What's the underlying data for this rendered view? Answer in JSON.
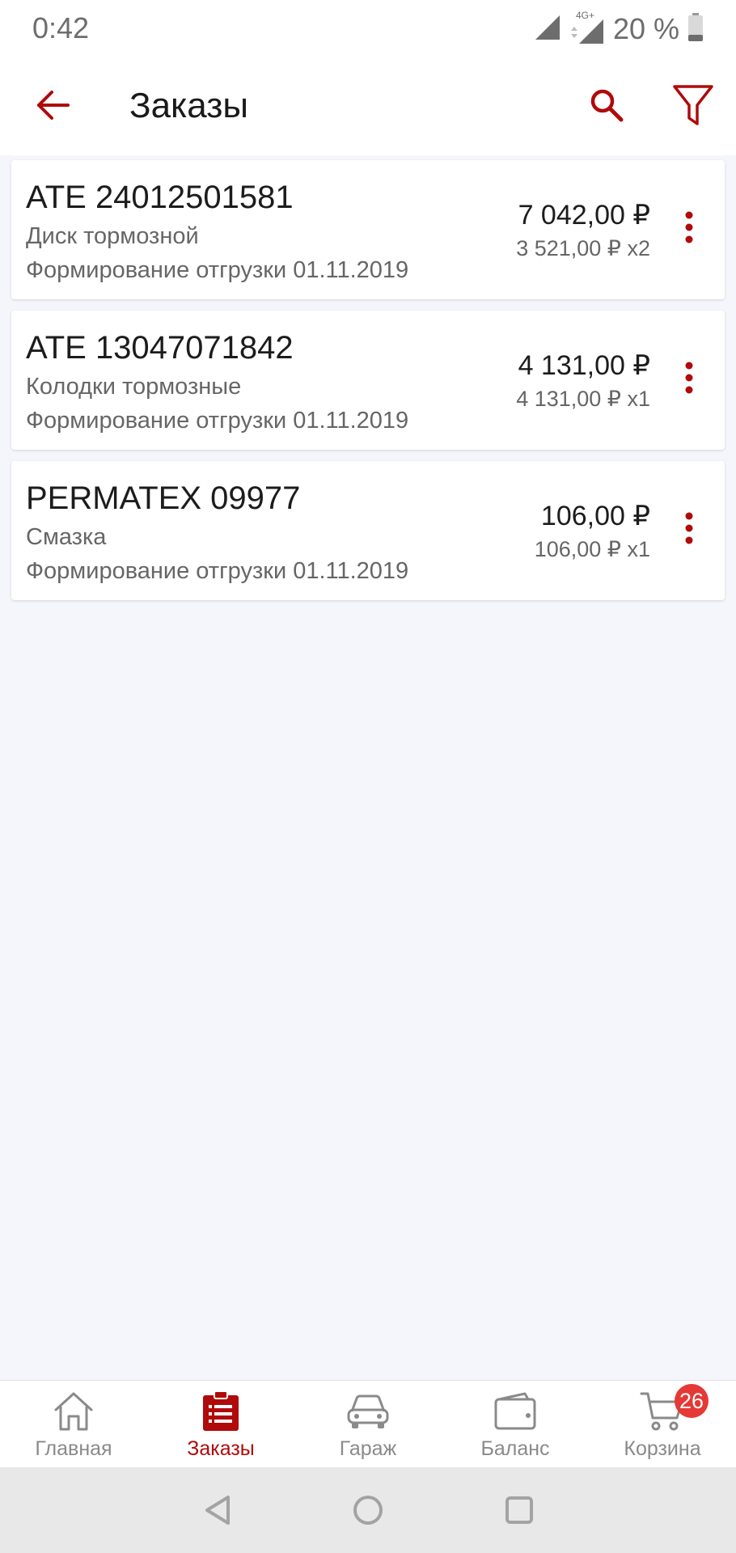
{
  "status_bar": {
    "time": "0:42",
    "network_type": "4G+",
    "battery_text": "20 %",
    "icons": [
      "signal-icon",
      "network-signal-icon",
      "battery-icon"
    ]
  },
  "app_bar": {
    "title": "Заказы",
    "icons": [
      "back-arrow-icon",
      "search-icon",
      "filter-icon"
    ]
  },
  "orders": [
    {
      "title": "ATE 24012501581",
      "description": "Диск тормозной",
      "status": "Формирование отгрузки 01.11.2019",
      "total": "7 042,00 ₽",
      "unit_price": "3 521,00 ₽ x2"
    },
    {
      "title": "ATE 13047071842",
      "description": "Колодки тормозные",
      "status": "Формирование отгрузки 01.11.2019",
      "total": "4 131,00 ₽",
      "unit_price": "4 131,00 ₽ x1"
    },
    {
      "title": "PERMATEX 09977",
      "description": "Смазка",
      "status": "Формирование отгрузки 01.11.2019",
      "total": "106,00 ₽",
      "unit_price": "106,00 ₽ x1"
    }
  ],
  "bottom_nav": {
    "items": [
      {
        "label": "Главная",
        "icon": "home-icon",
        "active": false
      },
      {
        "label": "Заказы",
        "icon": "orders-icon",
        "active": true
      },
      {
        "label": "Гараж",
        "icon": "car-icon",
        "active": false
      },
      {
        "label": "Баланс",
        "icon": "wallet-icon",
        "active": false
      },
      {
        "label": "Корзина",
        "icon": "cart-icon",
        "active": false
      }
    ],
    "cart_badge": "26"
  },
  "system_nav": {
    "icons": [
      "back-triangle-icon",
      "home-circle-icon",
      "recents-square-icon"
    ]
  },
  "colors": {
    "accent": "#b00a0a",
    "badge": "#e53935",
    "background": "#f5f6fb",
    "inactive": "#8a8a8a"
  }
}
